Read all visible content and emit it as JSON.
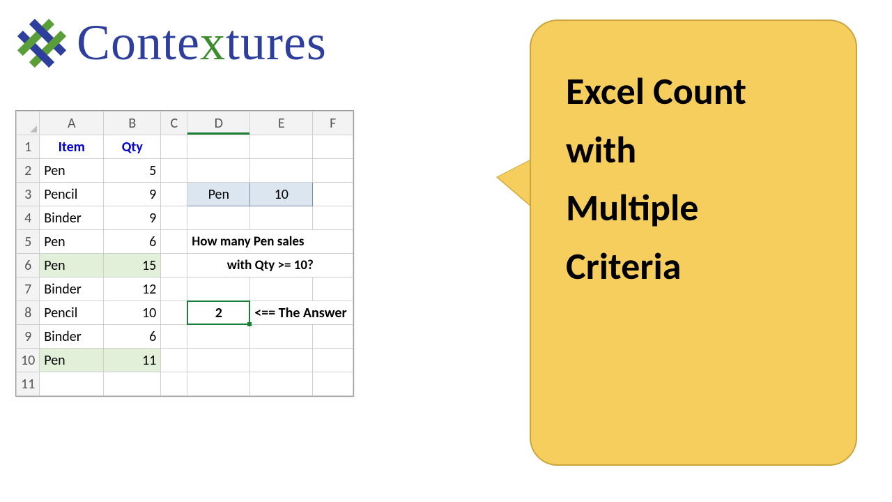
{
  "logo": {
    "text_pre": "Conte",
    "text_x": "x",
    "text_post": "tures"
  },
  "callout": {
    "line1": "Excel Count",
    "line2": "with",
    "line3": "Multiple",
    "line4": "Criteria"
  },
  "sheet": {
    "columns": [
      "A",
      "B",
      "C",
      "D",
      "E",
      "F"
    ],
    "row_numbers": [
      "1",
      "2",
      "3",
      "4",
      "5",
      "6",
      "7",
      "8",
      "9",
      "10",
      "11"
    ],
    "headers": {
      "A": "Item",
      "B": "Qty"
    },
    "data": [
      {
        "item": "Pen",
        "qty": "5",
        "hl": false
      },
      {
        "item": "Pencil",
        "qty": "9",
        "hl": false
      },
      {
        "item": "Binder",
        "qty": "9",
        "hl": false
      },
      {
        "item": "Pen",
        "qty": "6",
        "hl": false
      },
      {
        "item": "Pen",
        "qty": "15",
        "hl": true
      },
      {
        "item": "Binder",
        "qty": "12",
        "hl": false
      },
      {
        "item": "Pencil",
        "qty": "10",
        "hl": false
      },
      {
        "item": "Binder",
        "qty": "6",
        "hl": false
      },
      {
        "item": "Pen",
        "qty": "11",
        "hl": true
      }
    ],
    "criteria": {
      "D3": "Pen",
      "E3": "10"
    },
    "question": {
      "line1": "How many Pen sales",
      "line2": "with Qty >= 10?"
    },
    "answer": {
      "value": "2",
      "label": "<== The Answer"
    }
  }
}
